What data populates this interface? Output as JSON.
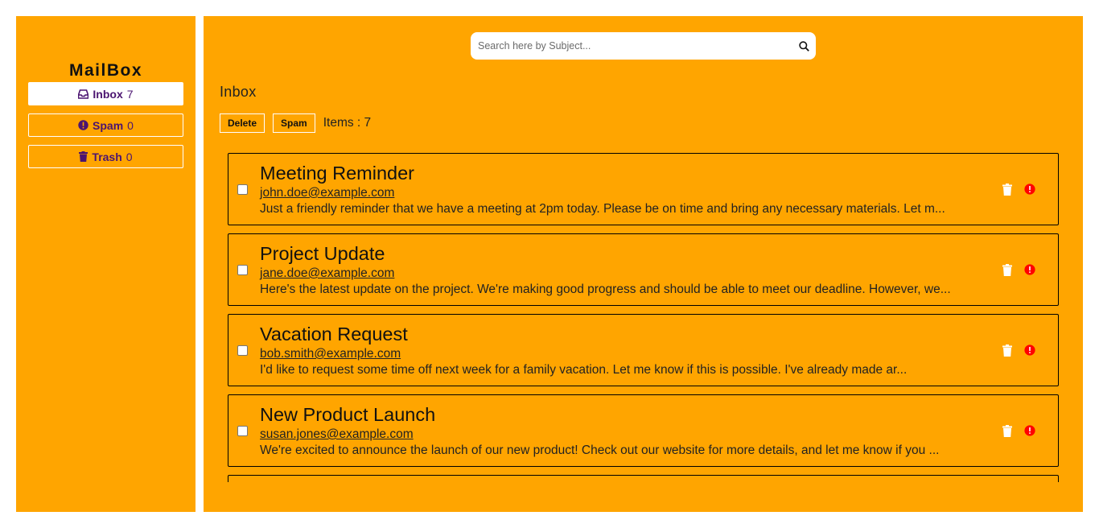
{
  "sidebar": {
    "title": "MailBox",
    "items": [
      {
        "label": "Inbox",
        "count": "7",
        "icon": "inbox-icon",
        "active": true
      },
      {
        "label": "Spam",
        "count": "0",
        "icon": "alert-circle-icon",
        "active": false
      },
      {
        "label": "Trash",
        "count": "0",
        "icon": "trash-icon",
        "active": false
      }
    ]
  },
  "search": {
    "placeholder": "Search here by Subject...",
    "value": "",
    "icon": "search-icon"
  },
  "main": {
    "heading": "Inbox",
    "toolbar": {
      "delete_label": "Delete",
      "spam_label": "Spam",
      "items_count": "Items : 7"
    }
  },
  "emails": [
    {
      "subject": "Meeting Reminder",
      "sender": "john.doe@example.com",
      "preview": "Just a friendly reminder that we have a meeting at 2pm today. Please be on time and bring any necessary materials. Let m..."
    },
    {
      "subject": "Project Update",
      "sender": "jane.doe@example.com",
      "preview": "Here's the latest update on the project. We're making good progress and should be able to meet our deadline. However, we..."
    },
    {
      "subject": "Vacation Request",
      "sender": "bob.smith@example.com",
      "preview": "I'd like to request some time off next week for a family vacation. Let me know if this is possible. I've already made ar..."
    },
    {
      "subject": "New Product Launch",
      "sender": "susan.jones@example.com",
      "preview": "We're excited to announce the launch of our new product! Check out our website for more details, and let me know if you ..."
    }
  ],
  "colors": {
    "background": "#ffa500",
    "page": "#ffffff",
    "nav_text": "#4b1470",
    "spam_icon": "#ff0000",
    "trash_icon": "#ffffff"
  }
}
